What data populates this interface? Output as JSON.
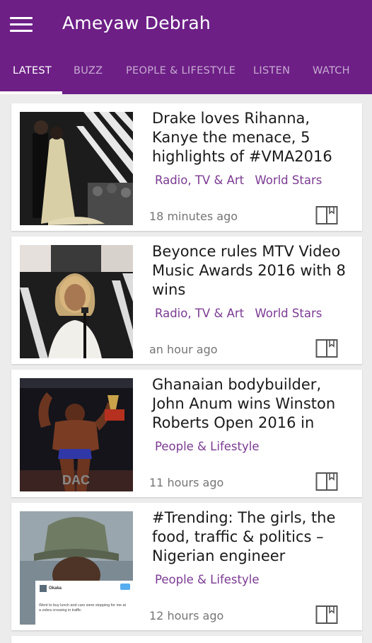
{
  "app": {
    "title": "Ameyaw Debrah"
  },
  "tabs": [
    {
      "label": "LATEST",
      "active": true
    },
    {
      "label": "BUZZ",
      "active": false
    },
    {
      "label": "PEOPLE & LIFESTYLE",
      "active": false
    },
    {
      "label": "LISTEN",
      "active": false
    },
    {
      "label": "WATCH",
      "active": false
    }
  ],
  "colors": {
    "brand": "#6d1f86",
    "tag": "#7b3a92",
    "background": "#ececec"
  },
  "articles": [
    {
      "headline": "Drake loves Rihanna, Kanye the menace, 5 highlights of #VMA2016",
      "tags": [
        "Radio, TV & Art",
        "World Stars"
      ],
      "time": "18 minutes ago",
      "icon": "bookmark-icon"
    },
    {
      "headline": "Beyonce rules MTV Video Music Awards 2016 with 8 wins",
      "tags": [
        "Radio, TV & Art",
        "World Stars"
      ],
      "time": "an hour ago",
      "icon": "bookmark-icon"
    },
    {
      "headline": "Ghanaian bodybuilder, John Anum wins Winston Roberts Open 2016 in",
      "tags": [
        "People & Lifestyle"
      ],
      "time": "11 hours ago",
      "icon": "bookmark-icon"
    },
    {
      "headline": "#Trending: The girls, the food, traffic & politics – Nigerian engineer",
      "tags": [
        "People & Lifestyle"
      ],
      "time": "12 hours ago",
      "icon": "bookmark-icon",
      "thumb_tweet": {
        "name": "Okaka",
        "text": "Went to buy lunch and cars were stopping for me at a zebra crossing in traffic"
      }
    }
  ]
}
